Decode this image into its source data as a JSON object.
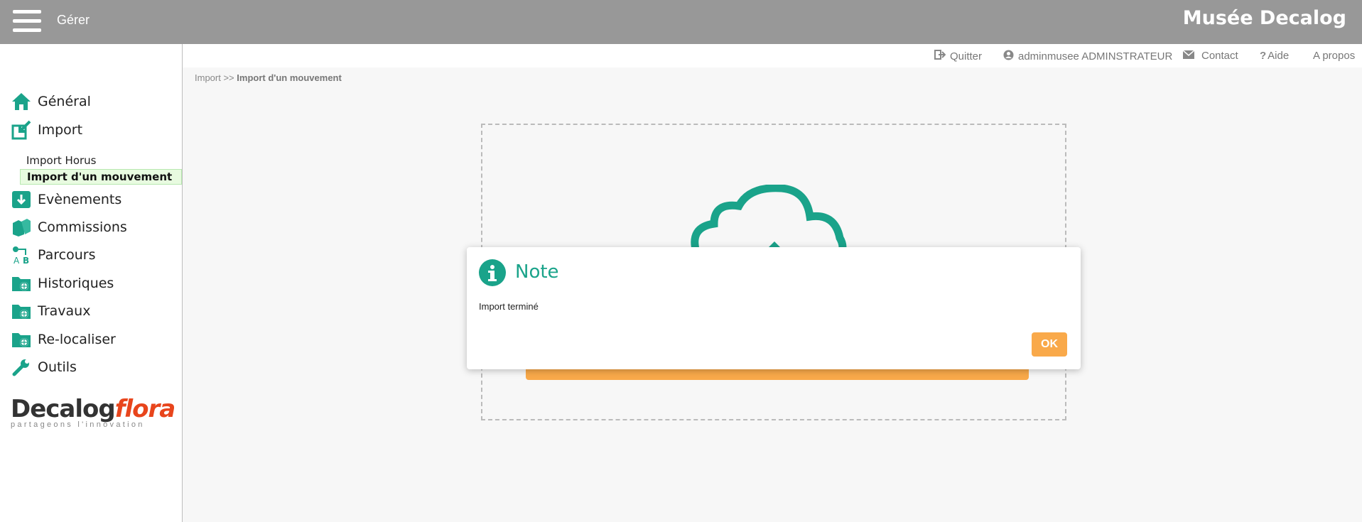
{
  "topbar": {
    "manage_label": "Gérer",
    "app_name": "Musée Decalog"
  },
  "sidebar": {
    "items": [
      {
        "label": "Général",
        "icon": "home-icon"
      },
      {
        "label": "Import",
        "icon": "import-icon"
      },
      {
        "label": "Evènements",
        "icon": "download-box-icon"
      },
      {
        "label": "Commissions",
        "icon": "boxes-icon"
      },
      {
        "label": "Parcours",
        "icon": "route-icon"
      },
      {
        "label": "Historiques",
        "icon": "folder-globe-icon"
      },
      {
        "label": "Travaux",
        "icon": "folder-globe-icon"
      },
      {
        "label": "Re-localiser",
        "icon": "folder-globe-icon"
      },
      {
        "label": "Outils",
        "icon": "wrench-icon"
      }
    ],
    "subitems": [
      {
        "label": "Import Horus"
      },
      {
        "label": "Import d'un mouvement"
      }
    ],
    "logo": {
      "word1": "Decalog",
      "word2": "flora",
      "tagline": "partageons l'innovation"
    }
  },
  "header_links": {
    "quit": "Quitter",
    "user": "adminmusee ADMINSTRATEUR",
    "contact": "Contact",
    "help": "Aide",
    "about": "A propos"
  },
  "breadcrumb": {
    "parent": "Import",
    "separator": ">>",
    "current": "Import d'un mouvement"
  },
  "modal": {
    "title": "Note",
    "message": "Import terminé",
    "ok_label": "OK"
  },
  "colors": {
    "accent": "#1aa38a",
    "orange": "#f9a94a",
    "topbar": "#989898",
    "active_bg": "#e8fbe0"
  }
}
